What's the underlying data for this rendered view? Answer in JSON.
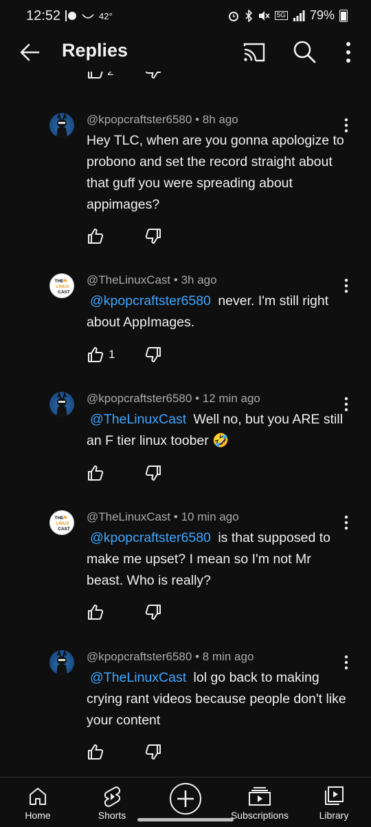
{
  "status_bar": {
    "time": "12:52",
    "temperature": "42°",
    "network": "5G",
    "battery": "79%"
  },
  "appbar": {
    "title": "Replies",
    "icons": [
      "back-arrow-icon",
      "cast-icon",
      "search-icon",
      "more-vert-icon"
    ]
  },
  "comments": [
    {
      "author": "@kpopcraftster6580",
      "time": "8h ago",
      "mention": "",
      "text": "Hey TLC, when are you gonna apologize to probono and set the record straight about that guff you were spreading about appimages?",
      "likes": "",
      "avatar": "kpop"
    },
    {
      "author": "@TheLinuxCast",
      "time": "3h ago",
      "mention": "@kpopcraftster6580",
      "text": "never. I'm still right about AppImages.",
      "likes": "1",
      "avatar": "tlc"
    },
    {
      "author": "@kpopcraftster6580",
      "time": "12 min ago",
      "mention": "@TheLinuxCast",
      "text": "Well no, but you ARE still an F tier linux toober 🤣",
      "likes": "",
      "avatar": "kpop"
    },
    {
      "author": "@TheLinuxCast",
      "time": "10 min ago",
      "mention": "@kpopcraftster6580",
      "text": "is that supposed to make me upset? I mean so I'm not Mr beast. Who is really?",
      "likes": "",
      "avatar": "tlc"
    },
    {
      "author": "@kpopcraftster6580",
      "time": "8 min ago",
      "mention": "@TheLinuxCast",
      "text": "lol go back to making crying rant videos because people don't like your content",
      "likes": "",
      "avatar": "kpop"
    }
  ],
  "tlc_avatar": {
    "line1": "THE",
    "line2": "LINUX",
    "line3": "CAST"
  },
  "clipped_count": "2",
  "bottom_nav": {
    "home": "Home",
    "shorts": "Shorts",
    "subscriptions": "Subscriptions",
    "library": "Library"
  },
  "colors": {
    "background": "#0f0f0f",
    "text": "#f1f1f1",
    "meta": "#aaaaaa",
    "mention": "#3ea6ff"
  }
}
